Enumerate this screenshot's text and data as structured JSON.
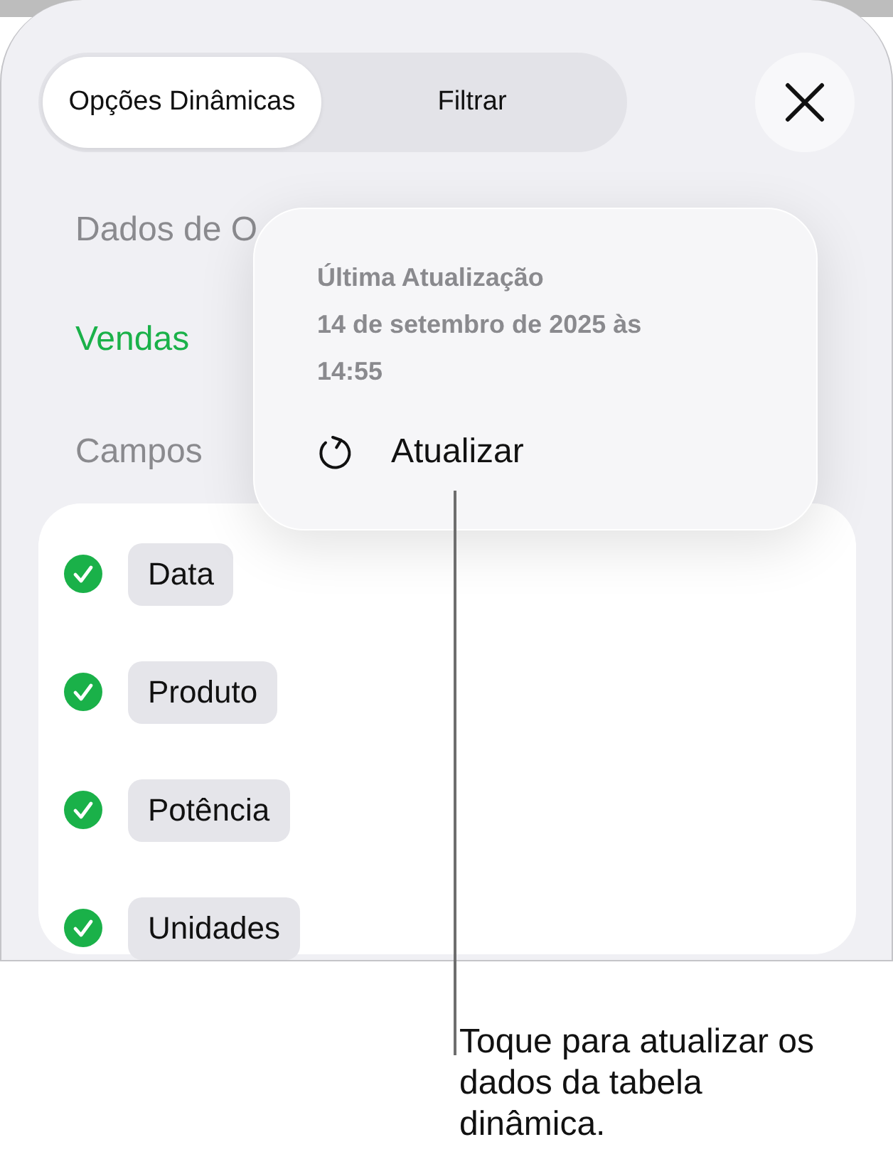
{
  "tabs": [
    {
      "label": "Opções Dinâmicas",
      "selected": true
    },
    {
      "label": "Filtrar",
      "selected": false
    }
  ],
  "source_heading": "Dados de O",
  "source_value": "Vendas",
  "fields_heading": "Campos",
  "fields": [
    {
      "label": "Data",
      "checked": true
    },
    {
      "label": "Produto",
      "checked": true
    },
    {
      "label": "Potência",
      "checked": true
    },
    {
      "label": "Unidades",
      "checked": true
    }
  ],
  "popover": {
    "title": "Última Atualização",
    "timestamp": "14 de setembro de 2025 às 14:55",
    "action": "Atualizar"
  },
  "callout": "Toque para atualizar os dados da tabela dinâmica."
}
